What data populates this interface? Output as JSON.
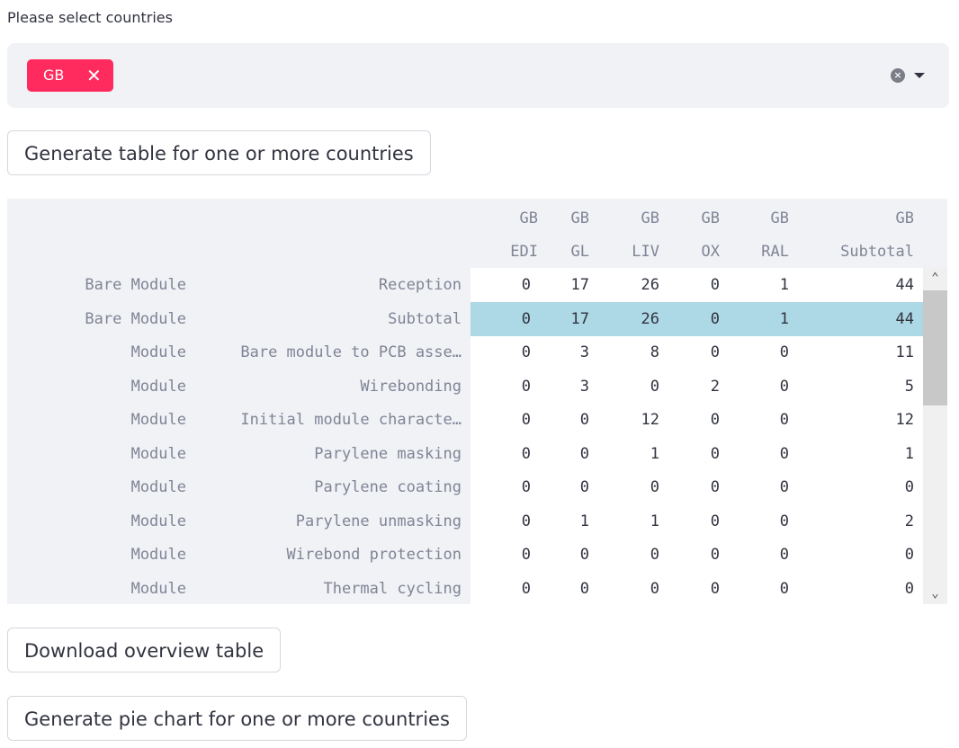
{
  "select": {
    "label": "Please select countries",
    "selected": [
      "GB"
    ]
  },
  "buttons": {
    "generate_table": "Generate table for one or more countries",
    "download": "Download overview table",
    "pie": "Generate pie chart for one or more countries"
  },
  "table": {
    "header_top": [
      "GB",
      "GB",
      "GB",
      "GB",
      "GB",
      "GB"
    ],
    "header_bottom": [
      "EDI",
      "GL",
      "LIV",
      "OX",
      "RAL",
      "Subtotal"
    ],
    "rows": [
      {
        "i0": "Bare Module",
        "i1": "Reception",
        "v": [
          "0",
          "17",
          "26",
          "0",
          "1",
          "44"
        ]
      },
      {
        "i0": "Bare Module",
        "i1": "Subtotal",
        "v": [
          "0",
          "17",
          "26",
          "0",
          "1",
          "44"
        ],
        "highlight": true
      },
      {
        "i0": "Module",
        "i1": "Bare module to PCB asse…",
        "v": [
          "0",
          "3",
          "8",
          "0",
          "0",
          "11"
        ]
      },
      {
        "i0": "Module",
        "i1": "Wirebonding",
        "v": [
          "0",
          "3",
          "0",
          "2",
          "0",
          "5"
        ]
      },
      {
        "i0": "Module",
        "i1": "Initial module characte…",
        "v": [
          "0",
          "0",
          "12",
          "0",
          "0",
          "12"
        ]
      },
      {
        "i0": "Module",
        "i1": "Parylene masking",
        "v": [
          "0",
          "0",
          "1",
          "0",
          "0",
          "1"
        ]
      },
      {
        "i0": "Module",
        "i1": "Parylene coating",
        "v": [
          "0",
          "0",
          "0",
          "0",
          "0",
          "0"
        ]
      },
      {
        "i0": "Module",
        "i1": "Parylene unmasking",
        "v": [
          "0",
          "1",
          "1",
          "0",
          "0",
          "2"
        ]
      },
      {
        "i0": "Module",
        "i1": "Wirebond protection",
        "v": [
          "0",
          "0",
          "0",
          "0",
          "0",
          "0"
        ]
      },
      {
        "i0": "Module",
        "i1": "Thermal cycling",
        "v": [
          "0",
          "0",
          "0",
          "0",
          "0",
          "0"
        ]
      }
    ]
  },
  "colors": {
    "tag": "#ff2b5e",
    "highlight": "#add8e6",
    "panel": "#f0f2f6"
  }
}
